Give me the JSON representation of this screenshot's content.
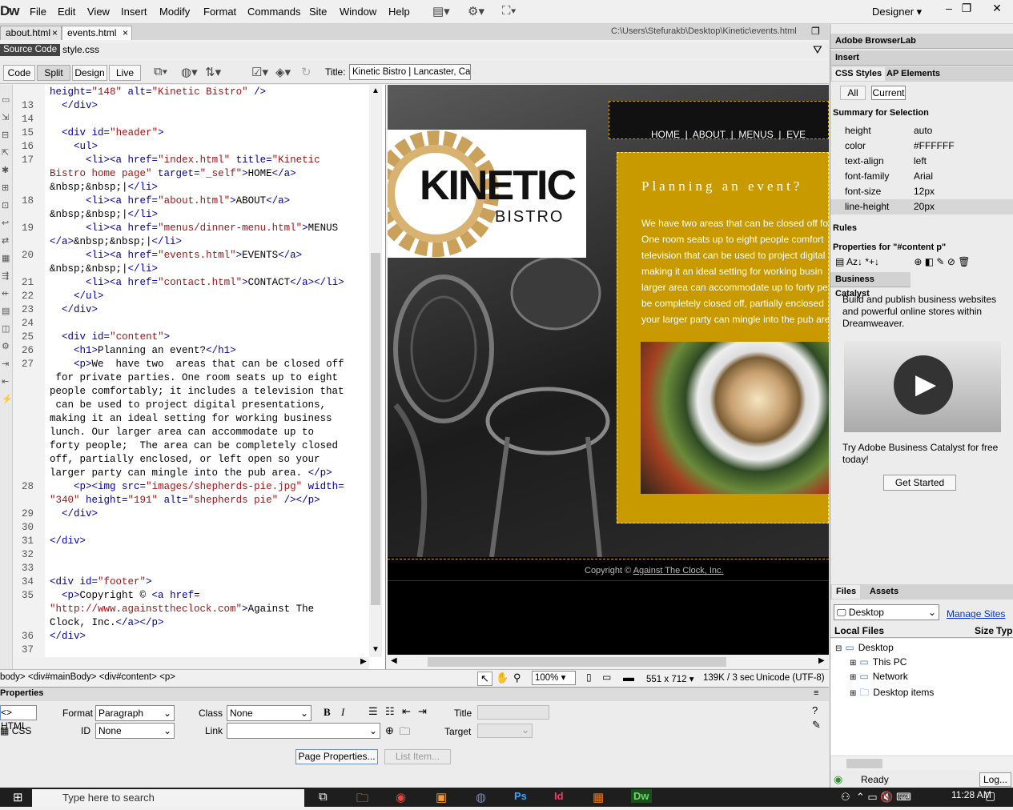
{
  "menubar": {
    "logo": "Dw",
    "items": [
      "File",
      "Edit",
      "View",
      "Insert",
      "Modify",
      "Format",
      "Commands",
      "Site",
      "Window",
      "Help"
    ],
    "workspace": "Designer",
    "window_controls": [
      "–",
      "❐",
      "✕"
    ]
  },
  "doc_tabs": [
    {
      "label": "about.html",
      "close": "×"
    },
    {
      "label": "events.html",
      "close": "×"
    }
  ],
  "doc_path": "C:\\Users\\Stefurakb\\Desktop\\Kinetic\\events.html",
  "related_files": {
    "source": "Source Code",
    "css": "style.css"
  },
  "view_buttons": [
    "Code",
    "Split",
    "Design",
    "Live"
  ],
  "active_view": "Split",
  "title_label": "Title:",
  "title_value": "Kinetic Bistro | Lancaster, Califo",
  "code_lines": [
    {
      "n": "",
      "html": "<span class='attr'>height=</span><span class='val'>\"148\"</span> <span class='attr'>alt=</span><span class='val'>\"Kinetic Bistro\"</span> <span class='tag'>/></span>"
    },
    {
      "n": "13",
      "html": "  <span class='tag'>&lt;/div&gt;</span>"
    },
    {
      "n": "14",
      "html": ""
    },
    {
      "n": "15",
      "html": "  <span class='tag'>&lt;div</span> <span class='attr'>id=</span><span class='val'>\"header\"</span><span class='tag'>&gt;</span>"
    },
    {
      "n": "16",
      "html": "    <span class='tag'>&lt;ul&gt;</span>"
    },
    {
      "n": "17",
      "html": "      <span class='tag'>&lt;li&gt;&lt;a</span> <span class='attr'>href=</span><span class='val'>\"index.html\"</span> <span class='attr'>title=</span><span class='val'>\"Kinetic</span>"
    },
    {
      "n": "",
      "html": "<span class='val'>Bistro home page\"</span> <span class='attr'>target=</span><span class='val'>\"_self\"</span><span class='tag'>&gt;</span>HOME<span class='tag'>&lt;/a&gt;</span>"
    },
    {
      "n": "",
      "html": "&amp;nbsp;&amp;nbsp;|<span class='tag'>&lt;/li&gt;</span>"
    },
    {
      "n": "18",
      "html": "      <span class='tag'>&lt;li&gt;&lt;a</span> <span class='attr'>href=</span><span class='val'>\"about.html\"</span><span class='tag'>&gt;</span>ABOUT<span class='tag'>&lt;/a&gt;</span>"
    },
    {
      "n": "",
      "html": "&amp;nbsp;&amp;nbsp;|<span class='tag'>&lt;/li&gt;</span>"
    },
    {
      "n": "19",
      "html": "      <span class='tag'>&lt;li&gt;&lt;a</span> <span class='attr'>href=</span><span class='val'>\"menus/dinner-menu.html\"</span><span class='tag'>&gt;</span>MENUS"
    },
    {
      "n": "",
      "html": "<span class='tag'>&lt;/a&gt;</span>&amp;nbsp;&amp;nbsp;|<span class='tag'>&lt;/li&gt;</span>"
    },
    {
      "n": "20",
      "html": "      <span class='tag'>&lt;li&gt;&lt;a</span> <span class='attr'>href=</span><span class='val'>\"events.html\"</span><span class='tag'>&gt;</span>EVENTS<span class='tag'>&lt;/a&gt;</span>"
    },
    {
      "n": "",
      "html": "&amp;nbsp;&amp;nbsp;|<span class='tag'>&lt;/li&gt;</span>"
    },
    {
      "n": "21",
      "html": "      <span class='tag'>&lt;li&gt;&lt;a</span> <span class='attr'>href=</span><span class='val'>\"contact.html\"</span><span class='tag'>&gt;</span>CONTACT<span class='tag'>&lt;/a&gt;&lt;/li&gt;</span>"
    },
    {
      "n": "22",
      "html": "    <span class='tag'>&lt;/ul&gt;</span>"
    },
    {
      "n": "23",
      "html": "  <span class='tag'>&lt;/div&gt;</span>"
    },
    {
      "n": "24",
      "html": ""
    },
    {
      "n": "25",
      "html": "  <span class='tag'>&lt;div</span> <span class='attr'>id=</span><span class='val'>\"content\"</span><span class='tag'>&gt;</span>"
    },
    {
      "n": "26",
      "html": "    <span class='tag'>&lt;h1&gt;</span>Planning an event?<span class='tag'>&lt;/h1&gt;</span>"
    },
    {
      "n": "27",
      "html": "    <span class='tag'>&lt;p&gt;</span>We  have two  areas that can be closed off"
    },
    {
      "n": "",
      "html": " for private parties. One room seats up to eight"
    },
    {
      "n": "",
      "html": "people comfortably; it includes a television that"
    },
    {
      "n": "",
      "html": " can be used to project digital presentations,"
    },
    {
      "n": "",
      "html": "making it an ideal setting for working business"
    },
    {
      "n": "",
      "html": "lunch. Our larger area can accommodate up to"
    },
    {
      "n": "",
      "html": "forty people;  The area can be completely closed"
    },
    {
      "n": "",
      "html": "off, partially enclosed, or left open so your"
    },
    {
      "n": "",
      "html": "larger party can mingle into the pub area. <span class='tag'>&lt;/p&gt;</span>"
    },
    {
      "n": "28",
      "html": "    <span class='tag'>&lt;p&gt;&lt;img</span> <span class='attr'>src=</span><span class='val'>\"images/shepherds-pie.jpg\"</span> <span class='attr'>width=</span>"
    },
    {
      "n": "",
      "html": "<span class='val'>\"340\"</span> <span class='attr'>height=</span><span class='val'>\"191\"</span> <span class='attr'>alt=</span><span class='val'>\"shepherds pie\"</span> <span class='tag'>/&gt;&lt;/p&gt;</span>"
    },
    {
      "n": "29",
      "html": "  <span class='tag'>&lt;/div&gt;</span>"
    },
    {
      "n": "30",
      "html": ""
    },
    {
      "n": "31",
      "html": "<span class='tag'>&lt;/div&gt;</span>"
    },
    {
      "n": "32",
      "html": ""
    },
    {
      "n": "33",
      "html": ""
    },
    {
      "n": "34",
      "html": "<span class='tag'>&lt;div</span> <span class='attr'>id=</span><span class='val'>\"footer\"</span><span class='tag'>&gt;</span>"
    },
    {
      "n": "35",
      "html": "  <span class='tag'>&lt;p&gt;</span>Copyright © <span class='tag'>&lt;a</span> <span class='attr'>href=</span>"
    },
    {
      "n": "",
      "html": "<span class='val'>\"http://www.againsttheclock.com\"</span><span class='tag'>&gt;</span>Against The"
    },
    {
      "n": "",
      "html": "Clock, Inc.<span class='tag'>&lt;/a&gt;&lt;/p&gt;</span>"
    },
    {
      "n": "36",
      "html": "<span class='tag'>&lt;/div&gt;</span>"
    },
    {
      "n": "37",
      "html": ""
    }
  ],
  "design": {
    "nav": "HOME  |  ABOUT  |  MENUS  |  EVE",
    "logo_main": "KINETIC",
    "logo_sub": "BISTRO",
    "heading": "Planning an event?",
    "paragraph_lines": [
      "We have two areas that can be closed off fo",
      "One room seats up to eight people comfort",
      "television that can be used to project digital",
      "making it an ideal setting for working busin",
      "larger area can accommodate up to forty pe",
      "be completely closed off, partially enclosed",
      "your larger party can mingle into the pub are"
    ],
    "footer_prefix": "Copyright © ",
    "footer_link": "Against The Clock, Inc."
  },
  "statusbar": {
    "tag_selector": "body> <div#mainBody> <div#content> <p>",
    "zoom": "100%",
    "dimensions": "551 x 712 ▾",
    "size_time": "139K / 3 sec",
    "encoding": "Unicode (UTF-8)"
  },
  "properties": {
    "title": "Properties",
    "html_tab": "HTML",
    "css_tab": "CSS",
    "format_label": "Format",
    "format_value": "Paragraph",
    "class_label": "Class",
    "class_value": "None",
    "id_label": "ID",
    "id_value": "None",
    "link_label": "Link",
    "link_value": "",
    "title_label": "Title",
    "target_label": "Target",
    "page_props_btn": "Page Properties...",
    "list_item_btn": "List Item..."
  },
  "right": {
    "browserlab": "Adobe BrowserLab",
    "insert": "Insert",
    "css_styles": "CSS Styles",
    "ap_elements": "AP Elements",
    "all": "All",
    "current": "Current",
    "summary_title": "Summary for Selection",
    "summary": [
      {
        "prop": "height",
        "val": "auto"
      },
      {
        "prop": "color",
        "val": "#FFFFFF"
      },
      {
        "prop": "text-align",
        "val": "left"
      },
      {
        "prop": "font-family",
        "val": "Arial"
      },
      {
        "prop": "font-size",
        "val": "12px"
      },
      {
        "prop": "line-height",
        "val": "20px"
      }
    ],
    "rules": "Rules",
    "props_for": "Properties for \"#content p\"",
    "bc_title": "Business Catalyst",
    "bc_text": "Build and publish business websites and powerful online stores within Dreamweaver.",
    "bc_try": "Try Adobe Business Catalyst for free today!",
    "bc_button": "Get Started",
    "files_tab": "Files",
    "assets_tab": "Assets",
    "site_select": "Desktop",
    "manage_sites": "Manage Sites",
    "local_files": "Local Files",
    "size_col": "Size",
    "type_col": "Typ",
    "tree": [
      {
        "label": "Desktop",
        "level": 0,
        "exp": "⊟"
      },
      {
        "label": "This PC",
        "level": 1,
        "exp": "⊞"
      },
      {
        "label": "Network",
        "level": 1,
        "exp": "⊞"
      },
      {
        "label": "Desktop items",
        "level": 1,
        "exp": "⊞"
      }
    ],
    "ready": "Ready",
    "log": "Log..."
  },
  "taskbar": {
    "search": "Type here to search",
    "time": "11:28 AM"
  }
}
